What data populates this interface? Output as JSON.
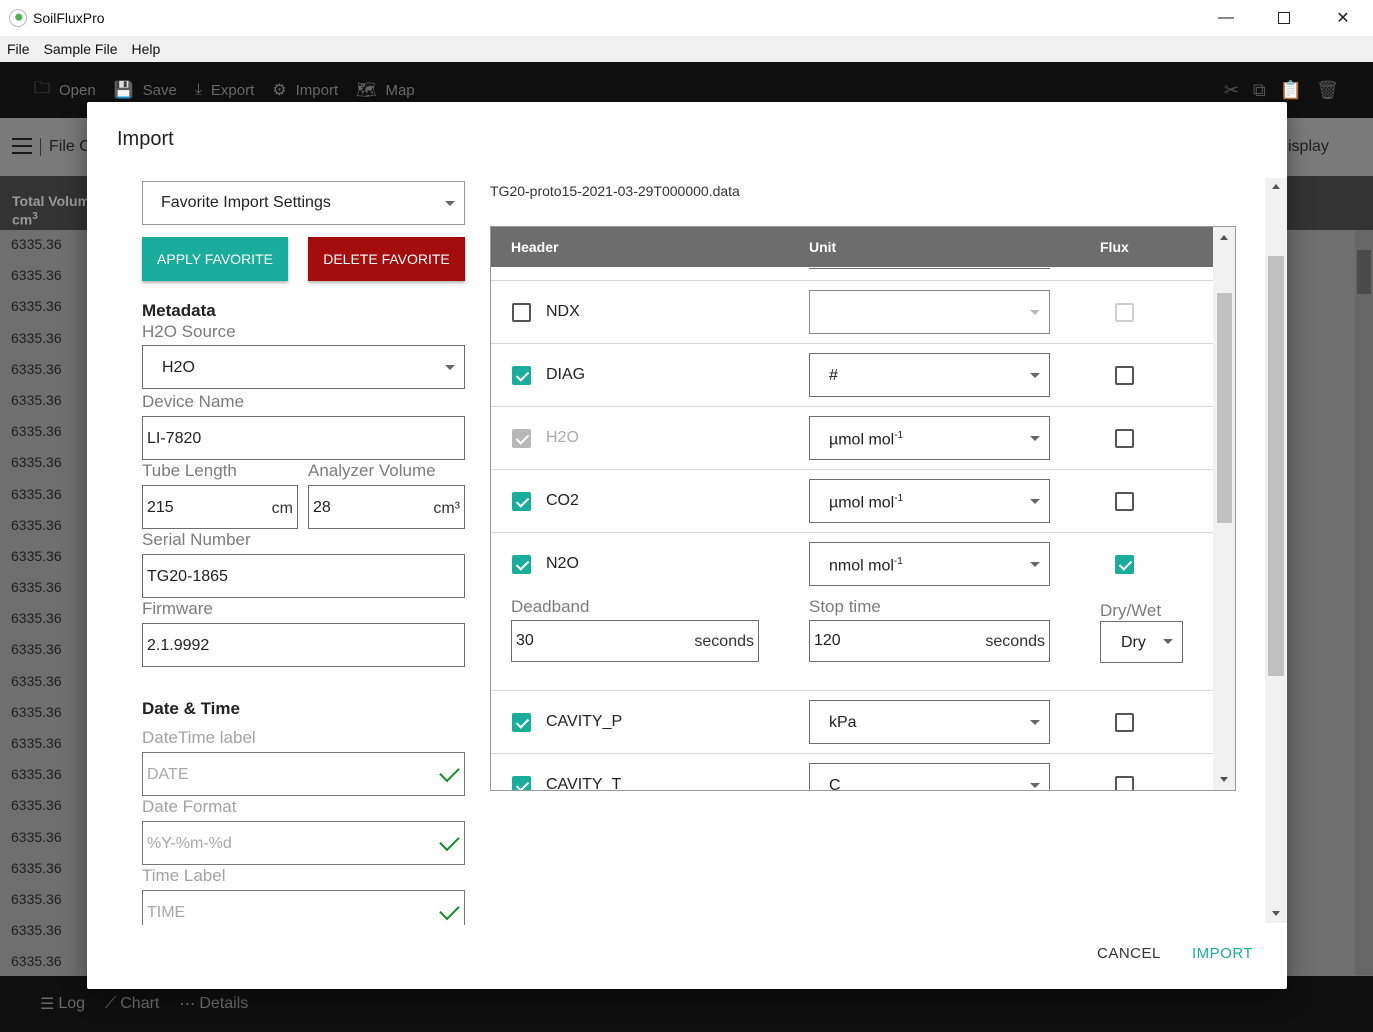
{
  "window": {
    "title": "SoilFluxPro",
    "minimize": "—",
    "close": "✕"
  },
  "menu": {
    "items": [
      "File",
      "Sample File",
      "Help"
    ]
  },
  "toolbar": {
    "buttons": [
      {
        "label": "Open",
        "icon": "folder-plus-icon",
        "glyph": "🗀"
      },
      {
        "label": "Save",
        "icon": "save-icon",
        "glyph": "💾"
      },
      {
        "label": "Export",
        "icon": "download-icon",
        "glyph": "⤓"
      },
      {
        "label": "Import",
        "icon": "import-icon",
        "glyph": "⚙"
      },
      {
        "label": "Map",
        "icon": "map-icon",
        "glyph": "🗺"
      }
    ],
    "right_icons": {
      "cut": "✂",
      "copy": "⧉",
      "paste": "📋",
      "delete": "🗑"
    }
  },
  "subheader": {
    "file_label": "File C",
    "display_label": "isplay"
  },
  "background_table": {
    "column_header": "Total Volum",
    "column_unit": "cm",
    "column_unit_sup": "3",
    "rows": [
      "6335.36",
      "6335.36",
      "6335.36",
      "6335.36",
      "6335.36",
      "6335.36",
      "6335.36",
      "6335.36",
      "6335.36",
      "6335.36",
      "6335.36",
      "6335.36",
      "6335.36",
      "6335.36",
      "6335.36",
      "6335.36",
      "6335.36",
      "6335.36",
      "6335.36",
      "6335.36",
      "6335.36",
      "6335.36",
      "6335.36",
      "6335.36"
    ]
  },
  "bottombar": {
    "log": {
      "label": "Log",
      "glyph": "☰"
    },
    "chart": {
      "label": "Chart",
      "glyph": "⟋"
    },
    "details": {
      "label": "Details",
      "glyph": "⋯"
    }
  },
  "dialog": {
    "title": "Import",
    "favorite_select": "Favorite Import Settings",
    "apply_favorite": "APPLY FAVORITE",
    "delete_favorite": "DELETE FAVORITE",
    "metadata_title": "Metadata",
    "h2o_source": {
      "label": "H2O Source",
      "value": "H2O"
    },
    "device_name": {
      "label": "Device Name",
      "value": "LI-7820"
    },
    "tube_length": {
      "label": "Tube Length",
      "value": "215",
      "unit": "cm"
    },
    "analyzer_volume": {
      "label": "Analyzer Volume",
      "value": "28",
      "unit": "cm³"
    },
    "serial_number": {
      "label": "Serial Number",
      "value": "TG20-1865"
    },
    "firmware": {
      "label": "Firmware",
      "value": "2.1.9992"
    },
    "datetime_title": "Date & Time",
    "datetime_label": {
      "label": "DateTime label",
      "value": "DATE"
    },
    "date_format": {
      "label": "Date Format",
      "value": "%Y-%m-%d"
    },
    "time_label": {
      "label": "Time Label",
      "value": "TIME"
    },
    "file_name": "TG20-proto15-2021-03-29T000000.data",
    "grid": {
      "headers": {
        "header": "Header",
        "unit": "Unit",
        "flux": "Flux"
      },
      "rows": {
        "ndx": {
          "name": "NDX",
          "unit": ""
        },
        "diag": {
          "name": "DIAG",
          "unit": "#"
        },
        "h2o": {
          "name": "H2O",
          "unit": "µmol mol",
          "sup": "-1"
        },
        "co2": {
          "name": "CO2",
          "unit": "µmol mol",
          "sup": "-1"
        },
        "n2o": {
          "name": "N2O",
          "unit": "nmol mol",
          "sup": "-1"
        },
        "cavity_p": {
          "name": "CAVITY_P",
          "unit": "kPa"
        },
        "cavity_t": {
          "name": "CAVITY_T",
          "unit": "C"
        }
      },
      "n2o_options": {
        "deadband": {
          "label": "Deadband",
          "value": "30",
          "unit": "seconds"
        },
        "stop_time": {
          "label": "Stop time",
          "value": "120",
          "unit": "seconds"
        },
        "dry_wet": {
          "label": "Dry/Wet",
          "value": "Dry"
        }
      }
    },
    "cancel": "CANCEL",
    "import": "IMPORT"
  }
}
